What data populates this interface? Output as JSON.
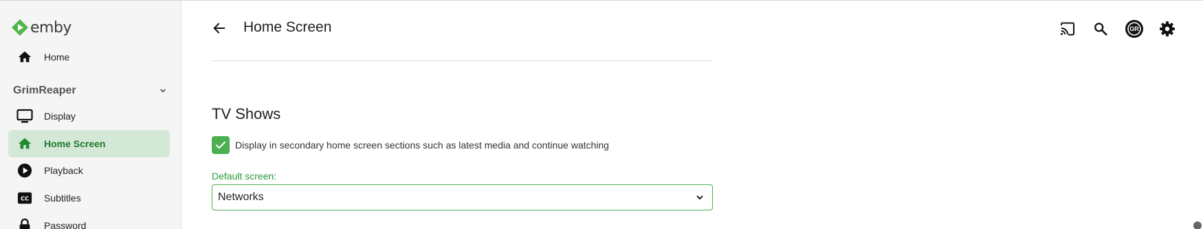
{
  "app": {
    "logo_text": "emby",
    "brand_color": "#52b54b"
  },
  "sidebar": {
    "home_label": "Home",
    "section_user": "GrimReaper",
    "items": [
      {
        "label": "Display",
        "icon": "monitor-icon"
      },
      {
        "label": "Home Screen",
        "icon": "home-icon",
        "active": true
      },
      {
        "label": "Playback",
        "icon": "play-circle-icon"
      },
      {
        "label": "Subtitles",
        "icon": "closed-caption-icon"
      },
      {
        "label": "Password",
        "icon": "lock-icon"
      }
    ]
  },
  "header": {
    "title": "Home Screen",
    "avatar_initials": "GR",
    "icons": [
      "cast-icon",
      "search-icon",
      "avatar",
      "gear-icon"
    ]
  },
  "main": {
    "section_title": "TV Shows",
    "checkbox": {
      "checked": true,
      "label": "Display in secondary home screen sections such as latest media and continue watching"
    },
    "default_screen": {
      "label": "Default screen:",
      "value": "Networks"
    }
  }
}
